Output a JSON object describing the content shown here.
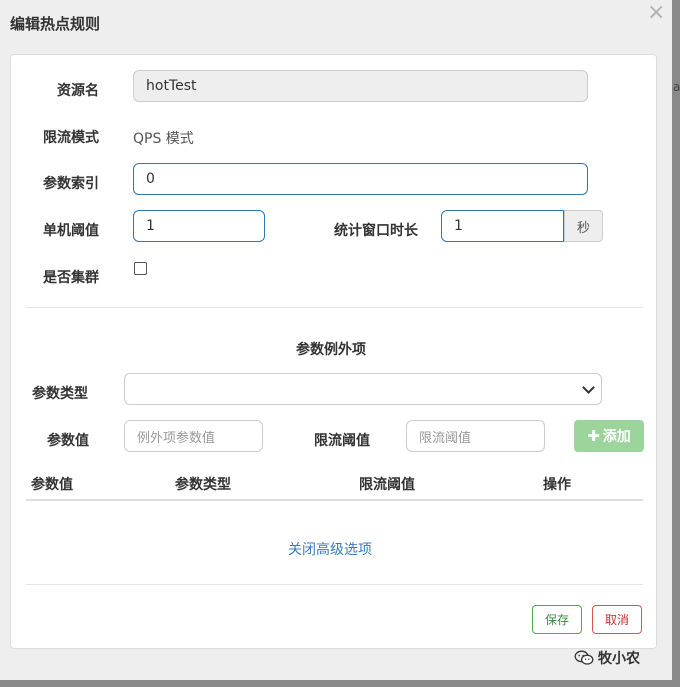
{
  "modal": {
    "title": "编辑热点规则",
    "close_glyph": "×"
  },
  "form": {
    "resource_label": "资源名",
    "resource_value": "hotTest",
    "mode_label": "限流模式",
    "mode_value": "QPS 模式",
    "param_index_label": "参数索引",
    "param_index_value": "0",
    "threshold_label": "单机阈值",
    "threshold_value": "1",
    "window_label": "统计窗口时长",
    "window_value": "1",
    "window_unit": "秒",
    "cluster_label": "是否集群",
    "cluster_checked": false
  },
  "exceptions": {
    "section_title": "参数例外项",
    "type_label": "参数类型",
    "type_selected": "",
    "value_label": "参数值",
    "value_placeholder": "例外项参数值",
    "limit_label": "限流阈值",
    "limit_placeholder": "限流阈值",
    "add_button": "添加",
    "add_icon": "plus-icon",
    "table_headers": [
      "参数值",
      "参数类型",
      "限流阈值",
      "操作"
    ],
    "rows": []
  },
  "advanced_link": "关闭高级选项",
  "actions": {
    "save": "保存",
    "cancel": "取消"
  },
  "background": {
    "edge_text": "ac"
  },
  "watermark": {
    "text": "牧小农",
    "icon": "wechat-icon"
  },
  "colors": {
    "primary_border": "#2f78b0",
    "add_button": "#9cd59c",
    "save": "#4cae4c",
    "cancel": "#d9534f",
    "link": "#3a7bbd"
  }
}
